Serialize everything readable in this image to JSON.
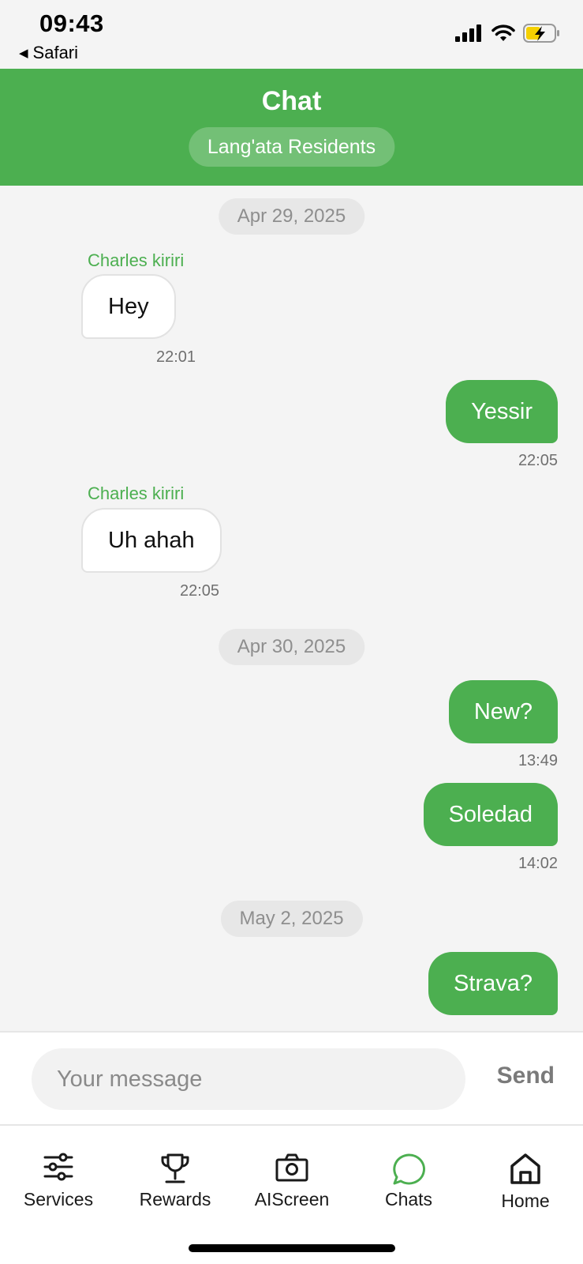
{
  "status_bar": {
    "time": "09:43",
    "back_app": "Safari",
    "icons": [
      "signal-icon",
      "wifi-icon",
      "battery-charging-icon"
    ],
    "battery_color": "#f5d000"
  },
  "header": {
    "title": "Chat",
    "group_name": "Lang'ata Residents",
    "background_color": "#4caf50"
  },
  "messages": [
    {
      "type": "date",
      "text": "Apr 29, 2025"
    },
    {
      "type": "incoming",
      "sender": "Charles kiriri",
      "text": "Hey",
      "time": "22:01"
    },
    {
      "type": "outgoing",
      "text": "Yessir",
      "time": "22:05"
    },
    {
      "type": "incoming",
      "sender": "Charles kiriri",
      "text": "Uh ahah",
      "time": "22:05"
    },
    {
      "type": "date",
      "text": "Apr 30, 2025"
    },
    {
      "type": "outgoing",
      "text": "New?",
      "time": "13:49"
    },
    {
      "type": "outgoing",
      "text": "Soledad",
      "time": "14:02"
    },
    {
      "type": "date",
      "text": "May 2, 2025"
    },
    {
      "type": "outgoing",
      "text": "Strava?",
      "time": ""
    }
  ],
  "composer": {
    "placeholder": "Your message",
    "value": "",
    "send_label": "Send"
  },
  "tabs": [
    {
      "label": "Services",
      "icon": "sliders-icon",
      "active": false
    },
    {
      "label": "Rewards",
      "icon": "trophy-icon",
      "active": false
    },
    {
      "label": "AIScreen",
      "icon": "camera-icon",
      "active": false
    },
    {
      "label": "Chats",
      "icon": "chat-bubble-icon",
      "active": true
    },
    {
      "label": "Home",
      "icon": "home-icon",
      "active": false
    }
  ],
  "colors": {
    "accent": "#4caf50",
    "incoming_bubble": "#ffffff",
    "date_pill": "#e7e7e7"
  }
}
